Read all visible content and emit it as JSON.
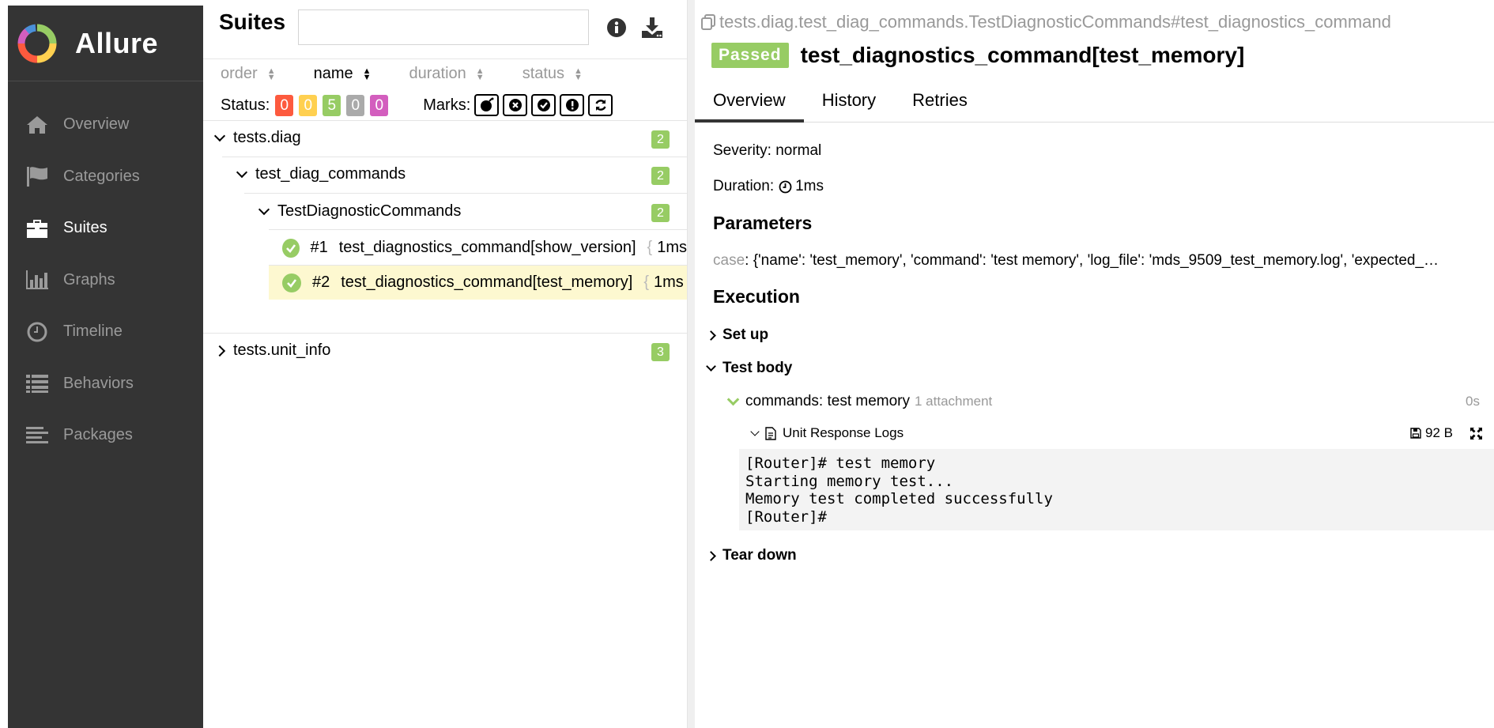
{
  "sidebar": {
    "brand": "Allure",
    "items": [
      {
        "label": "Overview",
        "icon": "home-icon",
        "active": false
      },
      {
        "label": "Categories",
        "icon": "flag-icon",
        "active": false
      },
      {
        "label": "Suites",
        "icon": "briefcase-icon",
        "active": true
      },
      {
        "label": "Graphs",
        "icon": "bar-chart-icon",
        "active": false
      },
      {
        "label": "Timeline",
        "icon": "clock-icon",
        "active": false
      },
      {
        "label": "Behaviors",
        "icon": "list-icon",
        "active": false
      },
      {
        "label": "Packages",
        "icon": "align-left-icon",
        "active": false
      }
    ]
  },
  "suites": {
    "title": "Suites",
    "search_placeholder": "",
    "sort": [
      "order",
      "name",
      "duration",
      "status"
    ],
    "status_label": "Status:",
    "status_counts": [
      {
        "value": "0",
        "color": "#fd5a3e"
      },
      {
        "value": "0",
        "color": "#ffd050"
      },
      {
        "value": "5",
        "color": "#97cc64"
      },
      {
        "value": "0",
        "color": "#aaaaaa"
      },
      {
        "value": "0",
        "color": "#d35ebe"
      }
    ],
    "marks_label": "Marks:",
    "tree": {
      "root": {
        "label": "tests.diag",
        "count": "2"
      },
      "module": {
        "label": "test_diag_commands",
        "count": "2"
      },
      "class": {
        "label": "TestDiagnosticCommands",
        "count": "2"
      },
      "tests": [
        {
          "num": "#1",
          "name": "test_diagnostics_command[show_version]",
          "duration": "1ms"
        },
        {
          "num": "#2",
          "name": "test_diagnostics_command[test_memory]",
          "duration": "1ms"
        }
      ],
      "other": {
        "label": "tests.unit_info",
        "count": "3"
      }
    }
  },
  "detail": {
    "path": "tests.diag.test_diag_commands.TestDiagnosticCommands#test_diagnostics_command",
    "status": "Passed",
    "name": "test_diagnostics_command[test_memory]",
    "tabs": [
      "Overview",
      "History",
      "Retries"
    ],
    "severity": "Severity: normal",
    "duration_label": "Duration:",
    "duration": "1ms",
    "parameters_heading": "Parameters",
    "param_key": "case",
    "param_value": ": {'name': 'test_memory', 'command': 'test memory', 'log_file': 'mds_9509_test_memory.log', 'expected_…",
    "execution_heading": "Execution",
    "setup": "Set up",
    "test_body": "Test body",
    "step": {
      "name": "commands: test memory",
      "attachments": "1 attachment",
      "time": "0s"
    },
    "attachment": {
      "name": "Unit Response Logs",
      "size": "92 B"
    },
    "log": "[Router]# test memory\nStarting memory test...\nMemory test completed successfully\n[Router]#",
    "teardown": "Tear down"
  }
}
